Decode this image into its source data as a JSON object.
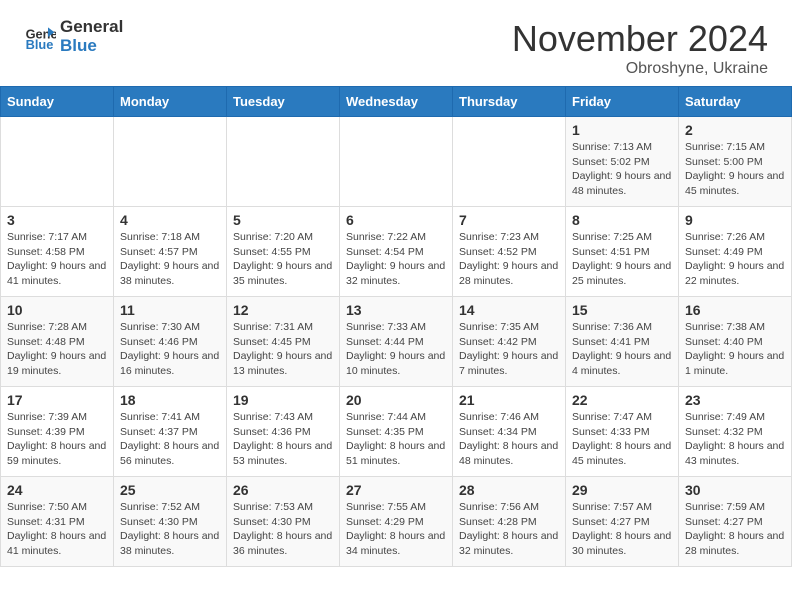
{
  "header": {
    "logo_general": "General",
    "logo_blue": "Blue",
    "month_title": "November 2024",
    "subtitle": "Obroshyne, Ukraine"
  },
  "weekdays": [
    "Sunday",
    "Monday",
    "Tuesday",
    "Wednesday",
    "Thursday",
    "Friday",
    "Saturday"
  ],
  "weeks": [
    [
      {
        "day": "",
        "info": ""
      },
      {
        "day": "",
        "info": ""
      },
      {
        "day": "",
        "info": ""
      },
      {
        "day": "",
        "info": ""
      },
      {
        "day": "",
        "info": ""
      },
      {
        "day": "1",
        "info": "Sunrise: 7:13 AM\nSunset: 5:02 PM\nDaylight: 9 hours and 48 minutes."
      },
      {
        "day": "2",
        "info": "Sunrise: 7:15 AM\nSunset: 5:00 PM\nDaylight: 9 hours and 45 minutes."
      }
    ],
    [
      {
        "day": "3",
        "info": "Sunrise: 7:17 AM\nSunset: 4:58 PM\nDaylight: 9 hours and 41 minutes."
      },
      {
        "day": "4",
        "info": "Sunrise: 7:18 AM\nSunset: 4:57 PM\nDaylight: 9 hours and 38 minutes."
      },
      {
        "day": "5",
        "info": "Sunrise: 7:20 AM\nSunset: 4:55 PM\nDaylight: 9 hours and 35 minutes."
      },
      {
        "day": "6",
        "info": "Sunrise: 7:22 AM\nSunset: 4:54 PM\nDaylight: 9 hours and 32 minutes."
      },
      {
        "day": "7",
        "info": "Sunrise: 7:23 AM\nSunset: 4:52 PM\nDaylight: 9 hours and 28 minutes."
      },
      {
        "day": "8",
        "info": "Sunrise: 7:25 AM\nSunset: 4:51 PM\nDaylight: 9 hours and 25 minutes."
      },
      {
        "day": "9",
        "info": "Sunrise: 7:26 AM\nSunset: 4:49 PM\nDaylight: 9 hours and 22 minutes."
      }
    ],
    [
      {
        "day": "10",
        "info": "Sunrise: 7:28 AM\nSunset: 4:48 PM\nDaylight: 9 hours and 19 minutes."
      },
      {
        "day": "11",
        "info": "Sunrise: 7:30 AM\nSunset: 4:46 PM\nDaylight: 9 hours and 16 minutes."
      },
      {
        "day": "12",
        "info": "Sunrise: 7:31 AM\nSunset: 4:45 PM\nDaylight: 9 hours and 13 minutes."
      },
      {
        "day": "13",
        "info": "Sunrise: 7:33 AM\nSunset: 4:44 PM\nDaylight: 9 hours and 10 minutes."
      },
      {
        "day": "14",
        "info": "Sunrise: 7:35 AM\nSunset: 4:42 PM\nDaylight: 9 hours and 7 minutes."
      },
      {
        "day": "15",
        "info": "Sunrise: 7:36 AM\nSunset: 4:41 PM\nDaylight: 9 hours and 4 minutes."
      },
      {
        "day": "16",
        "info": "Sunrise: 7:38 AM\nSunset: 4:40 PM\nDaylight: 9 hours and 1 minute."
      }
    ],
    [
      {
        "day": "17",
        "info": "Sunrise: 7:39 AM\nSunset: 4:39 PM\nDaylight: 8 hours and 59 minutes."
      },
      {
        "day": "18",
        "info": "Sunrise: 7:41 AM\nSunset: 4:37 PM\nDaylight: 8 hours and 56 minutes."
      },
      {
        "day": "19",
        "info": "Sunrise: 7:43 AM\nSunset: 4:36 PM\nDaylight: 8 hours and 53 minutes."
      },
      {
        "day": "20",
        "info": "Sunrise: 7:44 AM\nSunset: 4:35 PM\nDaylight: 8 hours and 51 minutes."
      },
      {
        "day": "21",
        "info": "Sunrise: 7:46 AM\nSunset: 4:34 PM\nDaylight: 8 hours and 48 minutes."
      },
      {
        "day": "22",
        "info": "Sunrise: 7:47 AM\nSunset: 4:33 PM\nDaylight: 8 hours and 45 minutes."
      },
      {
        "day": "23",
        "info": "Sunrise: 7:49 AM\nSunset: 4:32 PM\nDaylight: 8 hours and 43 minutes."
      }
    ],
    [
      {
        "day": "24",
        "info": "Sunrise: 7:50 AM\nSunset: 4:31 PM\nDaylight: 8 hours and 41 minutes."
      },
      {
        "day": "25",
        "info": "Sunrise: 7:52 AM\nSunset: 4:30 PM\nDaylight: 8 hours and 38 minutes."
      },
      {
        "day": "26",
        "info": "Sunrise: 7:53 AM\nSunset: 4:30 PM\nDaylight: 8 hours and 36 minutes."
      },
      {
        "day": "27",
        "info": "Sunrise: 7:55 AM\nSunset: 4:29 PM\nDaylight: 8 hours and 34 minutes."
      },
      {
        "day": "28",
        "info": "Sunrise: 7:56 AM\nSunset: 4:28 PM\nDaylight: 8 hours and 32 minutes."
      },
      {
        "day": "29",
        "info": "Sunrise: 7:57 AM\nSunset: 4:27 PM\nDaylight: 8 hours and 30 minutes."
      },
      {
        "day": "30",
        "info": "Sunrise: 7:59 AM\nSunset: 4:27 PM\nDaylight: 8 hours and 28 minutes."
      }
    ]
  ]
}
